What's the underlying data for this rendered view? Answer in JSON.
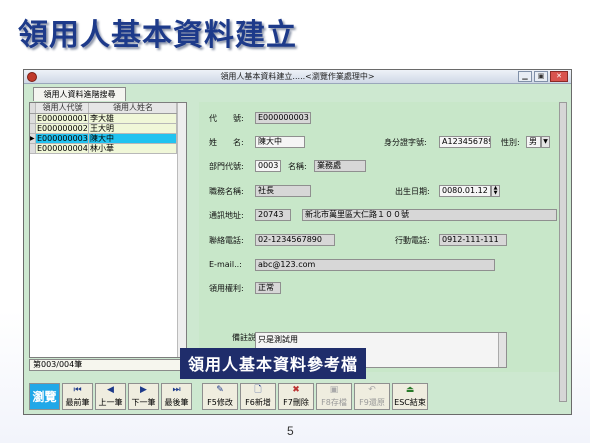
{
  "slide": {
    "title": "領用人基本資料建立",
    "page_number": "5",
    "caption": "領用人基本資料參考檔"
  },
  "window": {
    "title": "領用人基本資料建立.....<瀏覽作業處理中>",
    "adv_tab": "領用人資料進階搜尋"
  },
  "grid": {
    "headers": [
      "領用人代號",
      "領用人姓名"
    ],
    "rows": [
      {
        "id": "E000000001",
        "name": "李大雄"
      },
      {
        "id": "E000000002",
        "name": "王大明"
      },
      {
        "id": "E000000003",
        "name": "陳大中"
      },
      {
        "id": "E000000004",
        "name": "林小華"
      }
    ],
    "selected_row_index": 2,
    "pager": "第003/004筆"
  },
  "form": {
    "code_label": "代　　號:",
    "code": "E000000003",
    "name_label": "姓　　名:",
    "name": "陳大中",
    "idno_label": "身分證字號:",
    "idno": "A123456789",
    "gender_label": "性別:",
    "gender": "男",
    "dept_label": "部門代號:",
    "dept_code": "0003",
    "dept_name_label": "名稱:",
    "dept_name": "業務處",
    "title_label": "職務名稱:",
    "job_title": "社長",
    "birth_label": "出生日期:",
    "birth": "0080.01.12",
    "addr_label": "通訊地址:",
    "zip": "20743",
    "address": "新北市萬里區大仁路１００號",
    "phone_label": "聯絡電話:",
    "phone": "02-1234567890",
    "mobile_label": "行動電話:",
    "mobile": "0912-111-111",
    "email_label": "E-mail..:",
    "email": "abc@123.com",
    "right_label": "領用權利:",
    "right": "正常",
    "remark_label": "備註說明:",
    "remark": "只是測試用"
  },
  "toolbar": {
    "browse": "瀏覽",
    "first": "最前筆",
    "prev": "上一筆",
    "next": "下一筆",
    "last": "最後筆",
    "edit": "F5修改",
    "add": "F6新增",
    "delete": "F7刪除",
    "save": "F8存檔",
    "restore": "F9還原",
    "exit": "ESC結束"
  },
  "colors": {
    "window_bg": "#cde8d0",
    "selected_row": "#21c3f0",
    "title_blue": "#1d3a8a",
    "caption_bg": "#1f2d6b"
  }
}
